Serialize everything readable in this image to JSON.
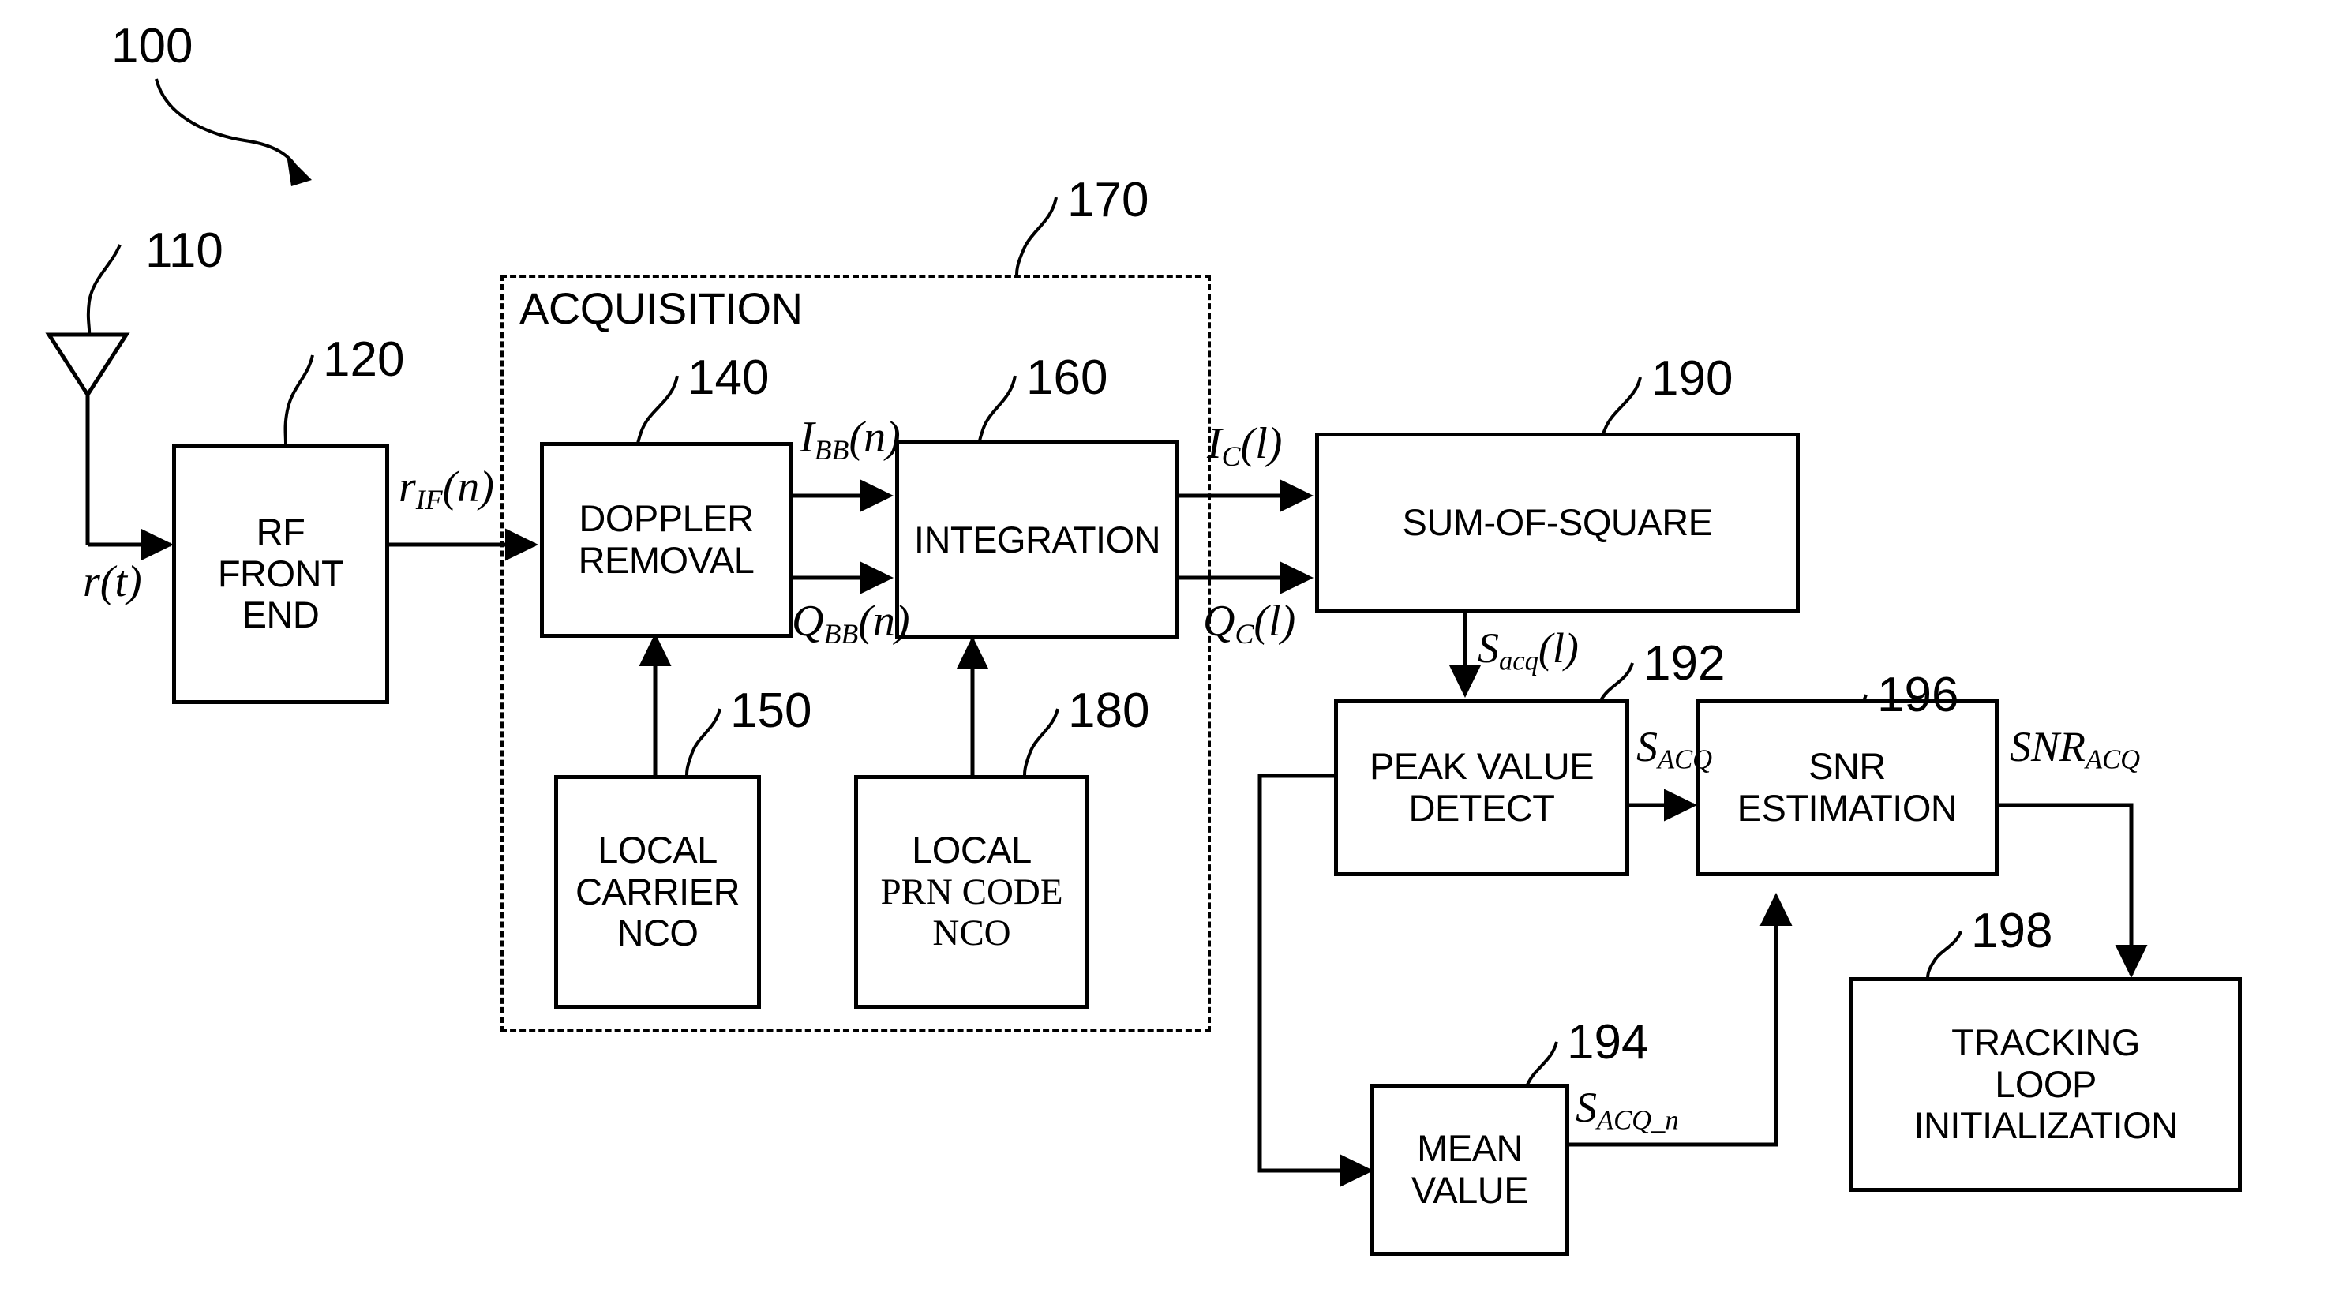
{
  "figure": {
    "type": "patent-block-diagram",
    "top_reference": "100"
  },
  "acquisition_group": {
    "title": "ACQUISITION",
    "ref": "170"
  },
  "blocks": [
    {
      "id": "antenna",
      "ref": "110",
      "lines": []
    },
    {
      "id": "rf_front_end",
      "ref": "120",
      "lines": [
        "RF",
        "FRONT",
        "END"
      ]
    },
    {
      "id": "doppler",
      "ref": "140",
      "lines": [
        "DOPPLER",
        "REMOVAL"
      ]
    },
    {
      "id": "local_carrier",
      "ref": "150",
      "lines": [
        "LOCAL",
        "CARRIER",
        "NCO"
      ]
    },
    {
      "id": "integration",
      "ref": "160",
      "lines": [
        "INTEGRATION"
      ]
    },
    {
      "id": "local_prn",
      "ref": "180",
      "lines": [
        "LOCAL",
        "PRN  CODE",
        "NCO"
      ]
    },
    {
      "id": "sum_of_square",
      "ref": "190",
      "lines": [
        "SUM-OF-SQUARE"
      ]
    },
    {
      "id": "peak_detect",
      "ref": "192",
      "lines": [
        "PEAK VALUE",
        "DETECT"
      ]
    },
    {
      "id": "mean_value",
      "ref": "194",
      "lines": [
        "MEAN",
        "VALUE"
      ]
    },
    {
      "id": "snr_estimation",
      "ref": "196",
      "lines": [
        "SNR",
        "ESTIMATION"
      ]
    },
    {
      "id": "tracking_loop",
      "ref": "198",
      "lines": [
        "TRACKING",
        "LOOP",
        "INITIALIZATION"
      ]
    }
  ],
  "block_text": {
    "rf_front_end": {
      "l1": "RF",
      "l2": "FRONT",
      "l3": "END"
    },
    "doppler": {
      "l1": "DOPPLER",
      "l2": "REMOVAL"
    },
    "local_carrier": {
      "l1": "LOCAL",
      "l2": "CARRIER",
      "l3": "NCO"
    },
    "integration": {
      "l1": "INTEGRATION"
    },
    "local_prn": {
      "l1": "LOCAL",
      "l2": "PRN  CODE",
      "l3": "NCO"
    },
    "sum_of_square": {
      "l1": "SUM-OF-SQUARE"
    },
    "peak_detect": {
      "l1": "PEAK VALUE",
      "l2": "DETECT"
    },
    "mean_value": {
      "l1": "MEAN",
      "l2": "VALUE"
    },
    "snr_estimation": {
      "l1": "SNR",
      "l2": "ESTIMATION"
    },
    "tracking_loop": {
      "l1": "TRACKING",
      "l2": "LOOP",
      "l3": "INITIALIZATION"
    }
  },
  "refs": {
    "r100": "100",
    "r110": "110",
    "r120": "120",
    "r140": "140",
    "r150": "150",
    "r160": "160",
    "r170": "170",
    "r180": "180",
    "r190": "190",
    "r192": "192",
    "r194": "194",
    "r196": "196",
    "r198": "198"
  },
  "signals": {
    "r_t": {
      "base": "r",
      "sub": "",
      "tail": "(t)"
    },
    "r_if_n": {
      "base": "r",
      "sub": "IF",
      "tail": "(n)"
    },
    "i_bb_n": {
      "base": "I",
      "sub": "BB",
      "tail": "(n)"
    },
    "q_bb_n": {
      "base": "Q",
      "sub": "BB",
      "tail": "(n)"
    },
    "i_c_l": {
      "base": "I",
      "sub": "C",
      "tail": "(l)"
    },
    "q_c_l": {
      "base": "Q",
      "sub": "C",
      "tail": "(l)"
    },
    "s_acq_l": {
      "base": "S",
      "sub": "acq",
      "tail": "(l)"
    },
    "s_ACQ": {
      "base": "S",
      "sub": "ACQ",
      "tail": ""
    },
    "s_ACQ_n": {
      "base": "S",
      "sub": "ACQ_n",
      "tail": ""
    },
    "snr_ACQ": {
      "base": "SNR",
      "sub": "ACQ",
      "tail": ""
    }
  },
  "colors": {
    "stroke": "#000000",
    "background": "#ffffff"
  }
}
